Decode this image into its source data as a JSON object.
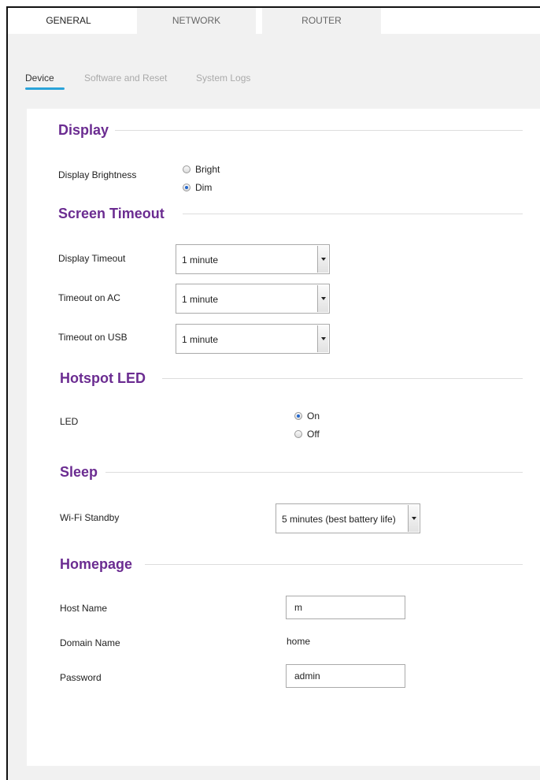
{
  "tabs": [
    {
      "label": "GENERAL",
      "active": true
    },
    {
      "label": "NETWORK",
      "active": false
    },
    {
      "label": "ROUTER",
      "active": false
    }
  ],
  "subtabs": [
    {
      "label": "Device",
      "active": true
    },
    {
      "label": "Software and Reset",
      "active": false
    },
    {
      "label": "System Logs",
      "active": false
    }
  ],
  "display": {
    "title": "Display",
    "brightness_label": "Display Brightness",
    "options": [
      "Bright",
      "Dim"
    ],
    "selected": "Dim"
  },
  "screen_timeout": {
    "title": "Screen Timeout",
    "display_timeout_label": "Display Timeout",
    "display_timeout_value": "1 minute",
    "ac_label": "Timeout on AC",
    "ac_value": "1 minute",
    "usb_label": "Timeout on USB",
    "usb_value": "1 minute"
  },
  "hotspot_led": {
    "title": "Hotspot LED",
    "led_label": "LED",
    "options": [
      "On",
      "Off"
    ],
    "selected": "On"
  },
  "sleep": {
    "title": "Sleep",
    "wifi_standby_label": "Wi-Fi Standby",
    "wifi_standby_value": "5 minutes (best battery life)"
  },
  "homepage": {
    "title": "Homepage",
    "host_name_label": "Host Name",
    "host_name_value": "m",
    "domain_name_label": "Domain Name",
    "domain_name_value": "home",
    "password_label": "Password",
    "password_value": "admin"
  },
  "colors": {
    "section_title": "#6b2c91",
    "subtab_underline": "#2aa3d9",
    "page_bg": "#f1f1f1"
  }
}
